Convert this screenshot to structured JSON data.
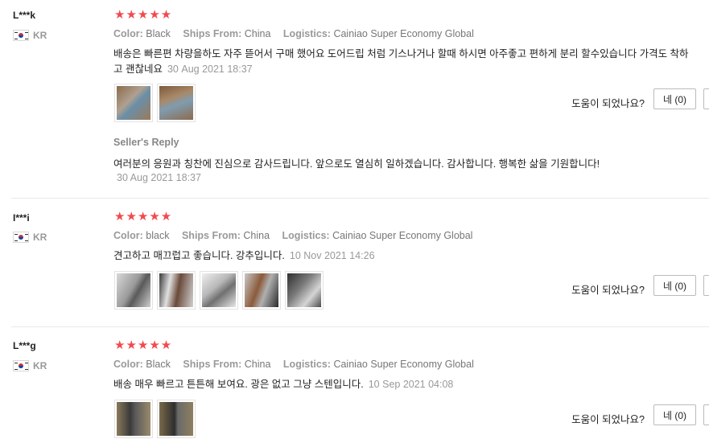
{
  "labels": {
    "color": "Color:",
    "ships_from": "Ships From:",
    "logistics": "Logistics:",
    "helpful": "도움이 되었나요?",
    "seller_reply": "Seller's Reply"
  },
  "reviews": [
    {
      "user": "L***k",
      "country": "KR",
      "stars": "★★★★★",
      "rating": 5,
      "color": "Black",
      "ships_from": "China",
      "logistics": "Cainiao Super Economy Global",
      "text": "배송은 빠른편 차량을하도 자주 뜯어서 구매 했어요 도어드립 처럼 기스나거나 할때 하시면 아주좋고 편하게 분리 할수있습니다 가격도 착하고 괜찮네요",
      "date": "30 Aug 2021 18:37",
      "photos": [
        "photo-1",
        "photo-2"
      ],
      "yes_label": "네 (0)",
      "reply": {
        "text": "여러분의 응원과 칭찬에 진심으로 감사드립니다. 앞으로도 열심히 일하겠습니다. 감사합니다. 행복한 삶을 기원합니다!",
        "date": "30 Aug 2021 18:37"
      }
    },
    {
      "user": "I***i",
      "country": "KR",
      "stars": "★★★★★",
      "rating": 5,
      "color": "black",
      "ships_from": "China",
      "logistics": "Cainiao Super Economy Global",
      "text": "견고하고 매끄럽고 좋습니다. 강추입니다.",
      "date": "10 Nov 2021 14:26",
      "photos": [
        "photo-1",
        "photo-2",
        "photo-3",
        "photo-4",
        "photo-5"
      ],
      "yes_label": "네 (0)"
    },
    {
      "user": "L***g",
      "country": "KR",
      "stars": "★★★★★",
      "rating": 5,
      "color": "Black",
      "ships_from": "China",
      "logistics": "Cainiao Super Economy Global",
      "text": "배송 매우 빠르고 튼튼해 보여요. 광은 없고 그냥 스텐입니다.",
      "date": "10 Sep 2021 04:08",
      "photos": [
        "photo-1",
        "photo-2"
      ],
      "yes_label": "네 (0)"
    }
  ],
  "colors": {
    "star": "#f04a4f",
    "muted": "#999999",
    "divider": "#e8e8e8"
  }
}
